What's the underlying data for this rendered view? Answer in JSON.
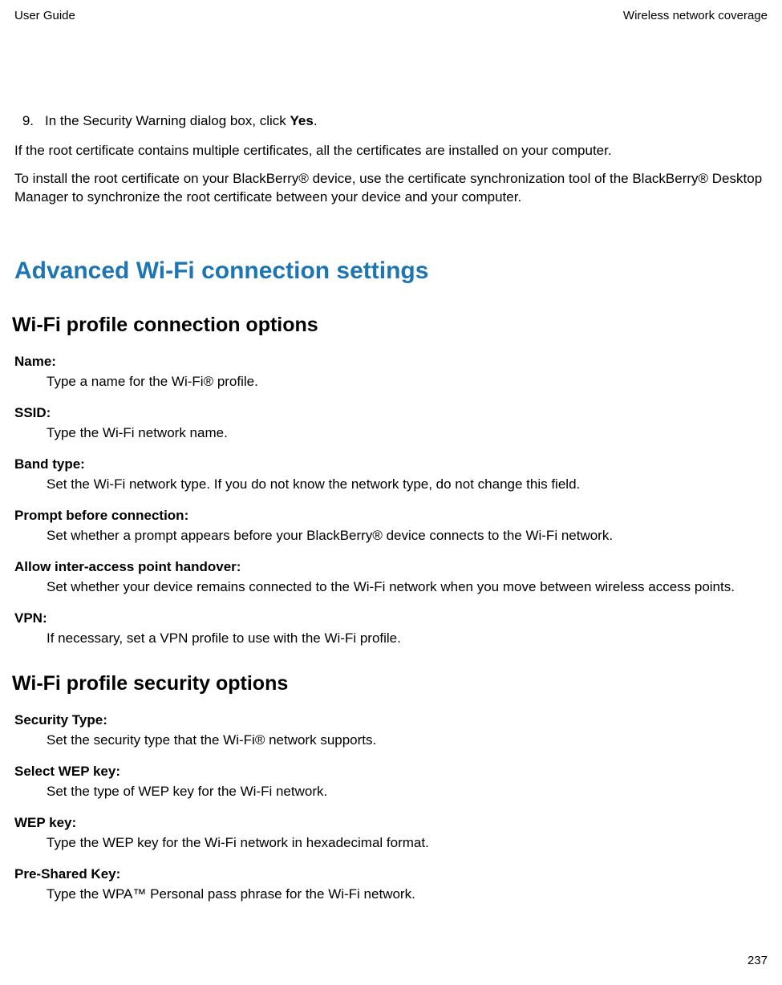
{
  "header": {
    "left": "User Guide",
    "right": "Wireless network coverage"
  },
  "step": {
    "number": "9.",
    "text_before": "In the Security Warning dialog box, click ",
    "text_bold": "Yes",
    "text_after": "."
  },
  "para1": "If the root certificate contains multiple certificates, all the certificates are installed on your computer.",
  "para2": "To install the root certificate on your BlackBerry® device, use the certificate synchronization tool of the BlackBerry® Desktop Manager to synchronize the root certificate between your device and your computer.",
  "h1": "Advanced Wi-Fi connection settings",
  "section1": {
    "title": "Wi-Fi profile connection options",
    "items": [
      {
        "term": "Name:",
        "desc": "Type a name for the Wi-Fi® profile."
      },
      {
        "term": "SSID:",
        "desc": "Type the Wi-Fi network name."
      },
      {
        "term": "Band type:",
        "desc": "Set the Wi-Fi network type. If you do not know the network type, do not change this field."
      },
      {
        "term": "Prompt before connection:",
        "desc": "Set whether a prompt appears before your BlackBerry® device connects to the Wi-Fi network."
      },
      {
        "term": "Allow inter-access point handover:",
        "desc": "Set whether your device remains connected to the Wi-Fi network when you move between wireless access points."
      },
      {
        "term": "VPN:",
        "desc": "If necessary, set a VPN profile to use with the Wi-Fi profile."
      }
    ]
  },
  "section2": {
    "title": "Wi-Fi profile security options",
    "items": [
      {
        "term": "Security Type:",
        "desc": "Set the security type that the Wi-Fi® network supports."
      },
      {
        "term": "Select WEP key:",
        "desc": "Set the type of WEP key for the Wi-Fi network."
      },
      {
        "term": "WEP key:",
        "desc": "Type the WEP key for the Wi-Fi network in hexadecimal format."
      },
      {
        "term": "Pre-Shared Key:",
        "desc": "Type the WPA™ Personal pass phrase for the Wi-Fi network."
      }
    ]
  },
  "footer": {
    "page": "237"
  }
}
